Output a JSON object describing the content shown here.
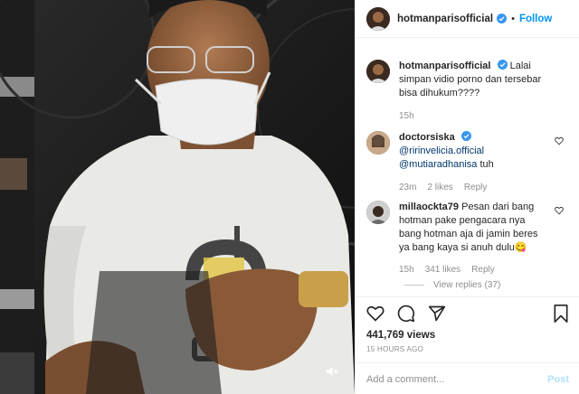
{
  "header": {
    "username": "hotmanparisofficial",
    "separator": "•",
    "follow_label": "Follow",
    "verified_icon": "verified-badge-icon"
  },
  "caption": {
    "username": "hotmanparisofficial",
    "text": "Lalai simpan vidio porno dan tersebar bisa dihukum????",
    "time": "15h"
  },
  "comments": [
    {
      "username": "doctorsiska",
      "mentions": [
        "@ririnvelicia.official",
        "@mutiaradhanisa"
      ],
      "text": "tuh",
      "time": "23m",
      "likes": "2 likes",
      "reply": "Reply"
    },
    {
      "username": "millaockta79",
      "text": "Pesan dari bang hotman pake pengacara nya bang hotman aja di jamin beres ya bang kaya si anuh dulu😋",
      "time": "15h",
      "likes": "341 likes",
      "reply": "Reply",
      "view_replies": "View replies (37)"
    }
  ],
  "actions": {
    "icons": [
      "heart-icon",
      "comment-icon",
      "share-icon",
      "bookmark-icon"
    ],
    "views": "441,769 views",
    "date": "15 HOURS AGO"
  },
  "add_comment": {
    "placeholder": "Add a comment...",
    "post_label": "Post"
  },
  "media": {
    "mute_icon": "speaker-muted-icon"
  },
  "colors": {
    "accent": "#0095f6",
    "post_disabled": "#b2dffc",
    "muted_text": "#8e8e8e"
  }
}
